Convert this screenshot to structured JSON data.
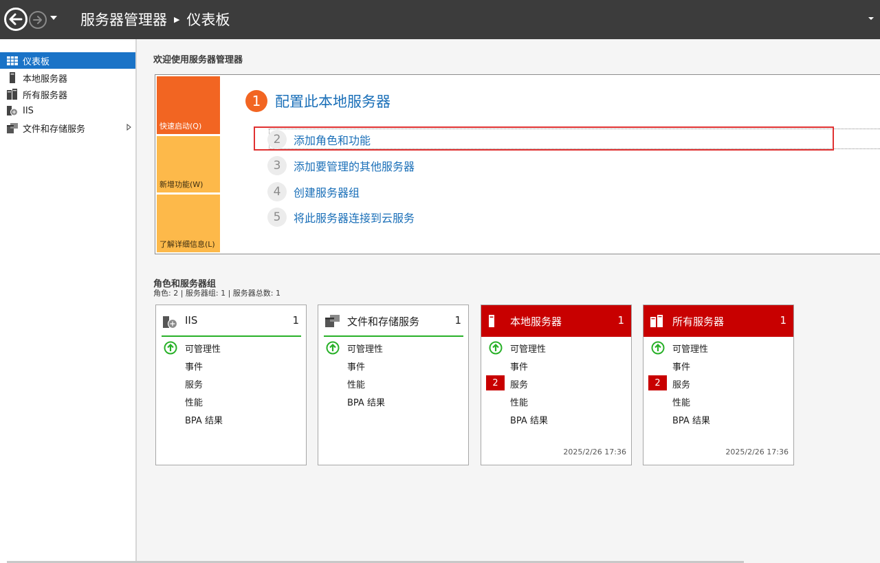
{
  "titlebar": {
    "app": "服务器管理器",
    "page": "仪表板"
  },
  "sidebar": {
    "items": [
      {
        "label": "仪表板",
        "icon": "dashboard-icon",
        "active": true
      },
      {
        "label": "本地服务器",
        "icon": "local-server-icon"
      },
      {
        "label": "所有服务器",
        "icon": "all-servers-icon"
      },
      {
        "label": "IIS",
        "icon": "iis-icon"
      },
      {
        "label": "文件和存储服务",
        "icon": "file-storage-icon",
        "expandable": true
      }
    ]
  },
  "welcome": {
    "title": "欢迎使用服务器管理器",
    "tiles": {
      "quick": "快速启动(Q)",
      "new": "新增功能(W)",
      "learn": "了解详细信息(L)"
    },
    "steps": [
      {
        "num": "1",
        "label": "配置此本地服务器"
      },
      {
        "num": "2",
        "label": "添加角色和功能"
      },
      {
        "num": "3",
        "label": "添加要管理的其他服务器"
      },
      {
        "num": "4",
        "label": "创建服务器组"
      },
      {
        "num": "5",
        "label": "将此服务器连接到云服务"
      }
    ]
  },
  "roles": {
    "title": "角色和服务器组",
    "summary": "角色: 2 | 服务器组: 1 | 服务器总数: 1",
    "tiles": [
      {
        "name": "IIS",
        "count": "1",
        "status": "ok",
        "rows": [
          "可管理性",
          "事件",
          "服务",
          "性能",
          "BPA 结果"
        ]
      },
      {
        "name": "文件和存储服务",
        "count": "1",
        "status": "ok",
        "rows": [
          "可管理性",
          "事件",
          "性能",
          "BPA 结果"
        ]
      },
      {
        "name": "本地服务器",
        "count": "1",
        "status": "error",
        "rows": [
          "可管理性",
          "事件",
          "服务",
          "性能",
          "BPA 结果"
        ],
        "service_errors": "2",
        "timestamp": "2025/2/26 17:36"
      },
      {
        "name": "所有服务器",
        "count": "1",
        "status": "error",
        "rows": [
          "可管理性",
          "事件",
          "服务",
          "性能",
          "BPA 结果"
        ],
        "service_errors": "2",
        "timestamp": "2025/2/26 17:36"
      }
    ]
  },
  "colors": {
    "accent_blue": "#1a73c7",
    "link_blue": "#1a6fb8",
    "orange": "#f26522",
    "amber": "#fdb94a",
    "error_red": "#c80000",
    "ok_green": "#27b027"
  }
}
